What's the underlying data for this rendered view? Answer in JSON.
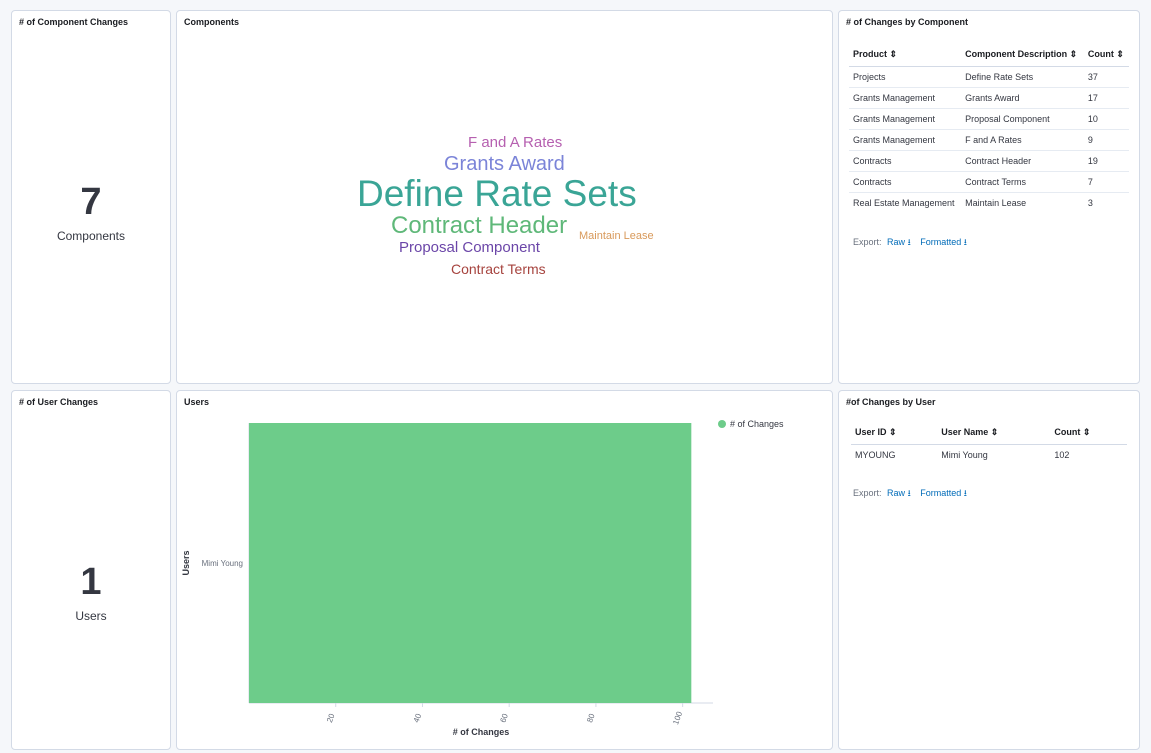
{
  "panels": {
    "component_changes": {
      "title": "# of Component Changes",
      "value": "7",
      "label": "Components"
    },
    "components": {
      "title": "Components",
      "words": [
        {
          "text": "F and A Rates",
          "color": "#b660b0"
        },
        {
          "text": "Grants Award",
          "color": "#7b84d8"
        },
        {
          "text": "Define Rate Sets",
          "color": "#3aa596"
        },
        {
          "text": "Contract Header",
          "color": "#5fb879"
        },
        {
          "text": "Maintain Lease",
          "color": "#d8995a"
        },
        {
          "text": "Proposal Component",
          "color": "#6b46a8"
        },
        {
          "text": "Contract Terms",
          "color": "#a6433e"
        }
      ]
    },
    "changes_by_component": {
      "title": "# of Changes by Component",
      "columns": [
        "Product ⇕",
        "Component Description ⇕",
        "Count ⇕"
      ],
      "rows": [
        [
          "Projects",
          "Define Rate Sets",
          "37"
        ],
        [
          "Grants Management",
          "Grants Award",
          "17"
        ],
        [
          "Grants Management",
          "Proposal Component",
          "10"
        ],
        [
          "Grants Management",
          "F and A Rates",
          "9"
        ],
        [
          "Contracts",
          "Contract Header",
          "19"
        ],
        [
          "Contracts",
          "Contract Terms",
          "7"
        ],
        [
          "Real Estate Management",
          "Maintain Lease",
          "3"
        ]
      ],
      "export_label": "Export:",
      "raw_label": "Raw",
      "formatted_label": "Formatted"
    },
    "user_changes": {
      "title": "# of User Changes",
      "value": "1",
      "label": "Users"
    },
    "users": {
      "title": "Users"
    },
    "changes_by_user": {
      "title": "#of Changes by User",
      "columns": [
        "User ID ⇕",
        "User Name ⇕",
        "Count ⇕"
      ],
      "rows": [
        [
          "MYOUNG",
          "Mimi Young",
          "102"
        ]
      ],
      "export_label": "Export:",
      "raw_label": "Raw",
      "formatted_label": "Formatted"
    }
  },
  "chart_data": {
    "type": "bar",
    "orientation": "horizontal",
    "categories": [
      "Mimi Young"
    ],
    "series": [
      {
        "name": "# of Changes",
        "values": [
          102
        ],
        "color": "#6dcc8a"
      }
    ],
    "xlabel": "# of Changes",
    "ylabel": "Users",
    "xticks": [
      20,
      40,
      60,
      80,
      100
    ],
    "xlim": [
      0,
      107
    ],
    "legend": "top-right"
  }
}
